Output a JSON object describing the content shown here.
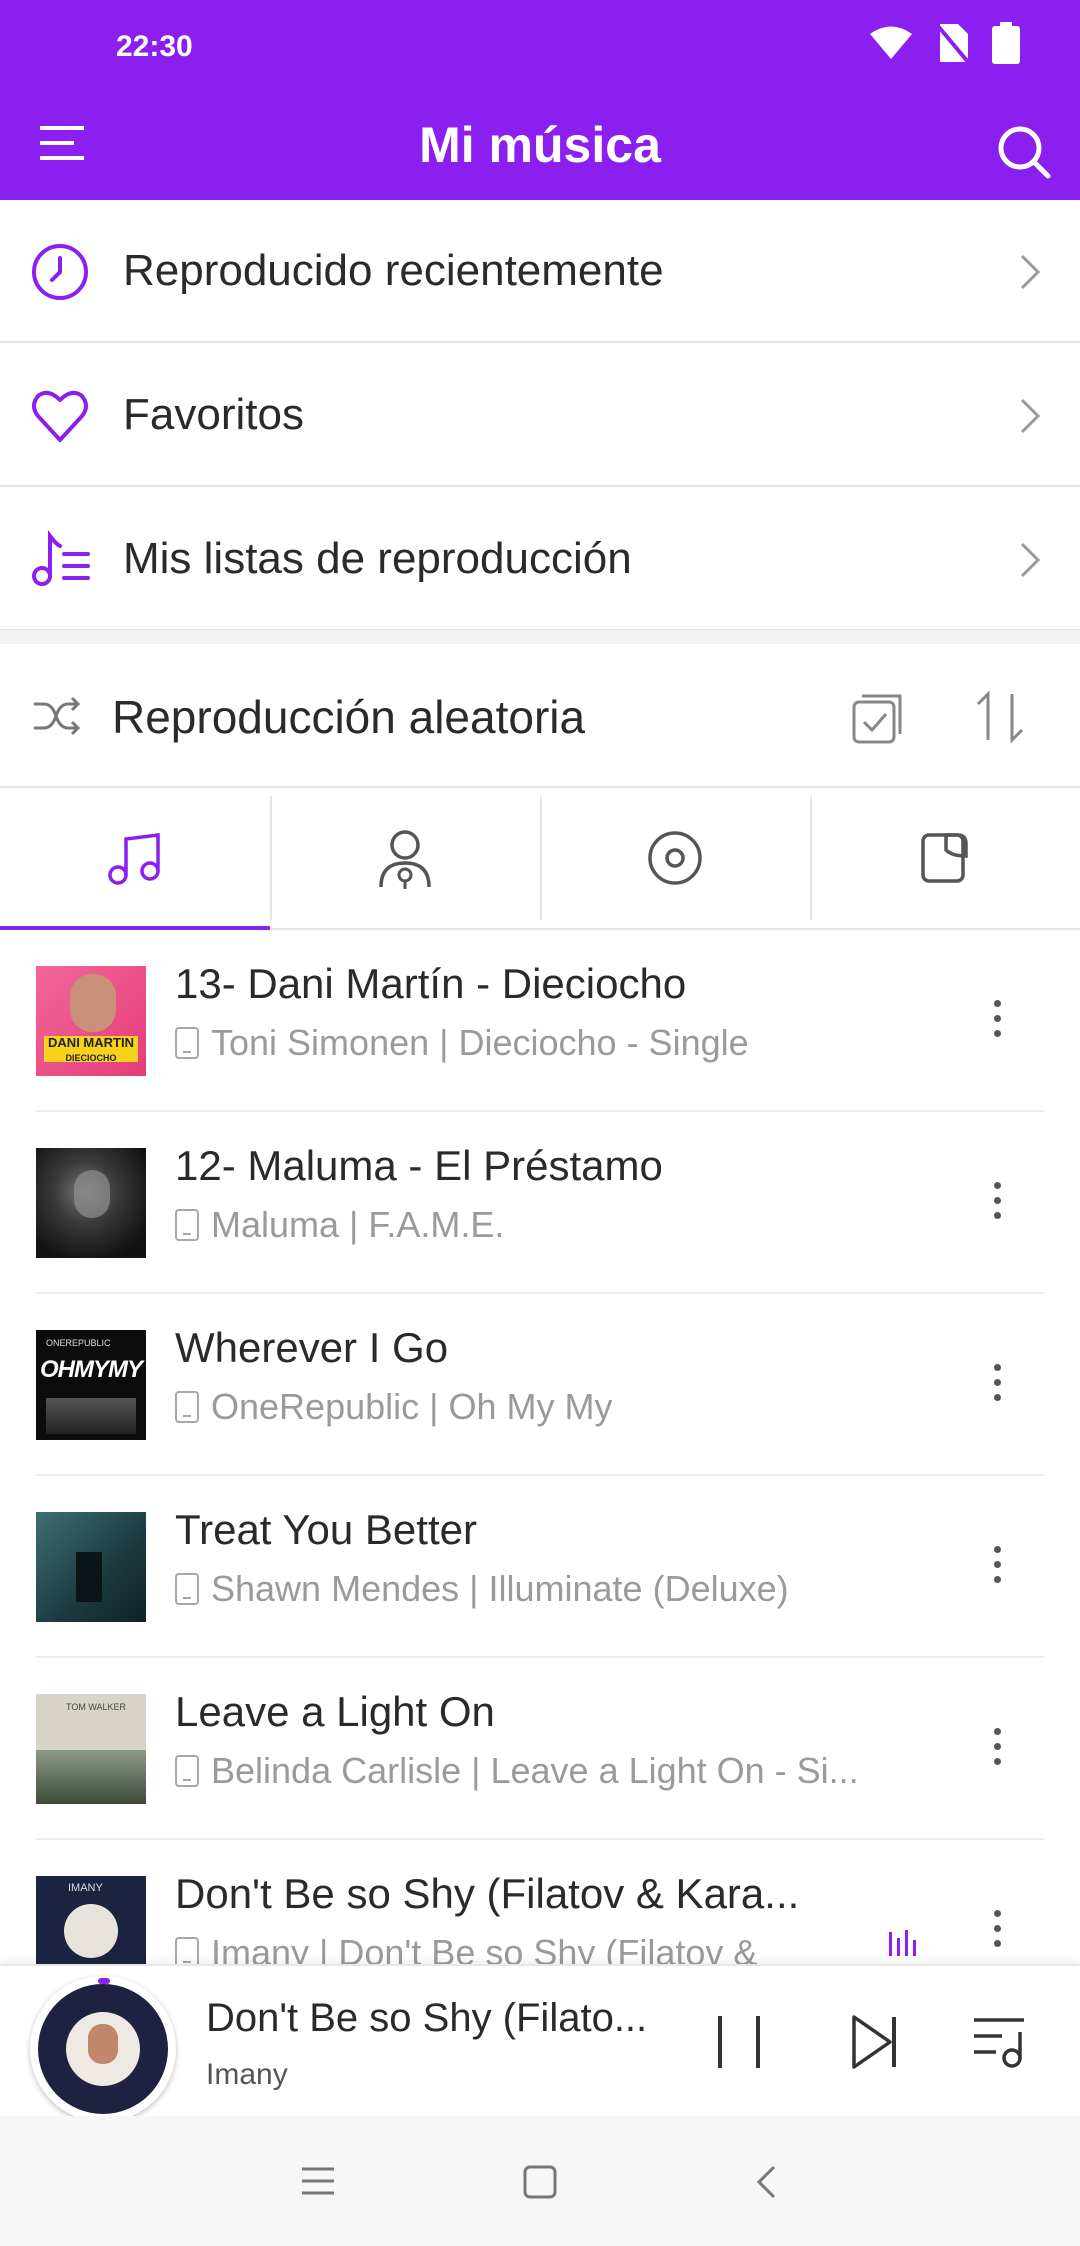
{
  "status": {
    "time": "22:30"
  },
  "header": {
    "title": "Mi música"
  },
  "nav": [
    {
      "label": "Reproducido recientemente"
    },
    {
      "label": "Favoritos"
    },
    {
      "label": "Mis listas de reproducción"
    }
  ],
  "shuffle": {
    "label": "Reproducción aleatoria"
  },
  "tabs": [
    "songs-icon",
    "artists-icon",
    "albums-icon",
    "folders-icon"
  ],
  "songs": [
    {
      "title": "13- Dani Martín - Dieciocho",
      "subtitle": "Toni Simonen | Dieciocho - Single",
      "art_text": "DANI MARTIN",
      "art_subtext": "DIECIOCHO"
    },
    {
      "title": "12- Maluma - El Préstamo",
      "subtitle": "Maluma | F.A.M.E."
    },
    {
      "title": "Wherever I Go",
      "subtitle": "OneRepublic | Oh My My",
      "art_text": "OHMYMY",
      "art_subtext": "ONEREPUBLIC"
    },
    {
      "title": "Treat You Better",
      "subtitle": "Shawn Mendes | Illuminate (Deluxe)"
    },
    {
      "title": "Leave a Light On",
      "subtitle": "Belinda Carlisle | Leave a Light On - Si...",
      "art_text": "TOM WALKER"
    },
    {
      "title": "Don't Be so Shy (Filatov & Kara...",
      "subtitle": "Imany | Don't Be so Shy (Filatov &",
      "art_text": "IMANY"
    }
  ],
  "now_playing": {
    "title": "Don't Be so Shy (Filato...",
    "artist": "Imany"
  },
  "colors": {
    "accent": "#8a1ff0"
  }
}
